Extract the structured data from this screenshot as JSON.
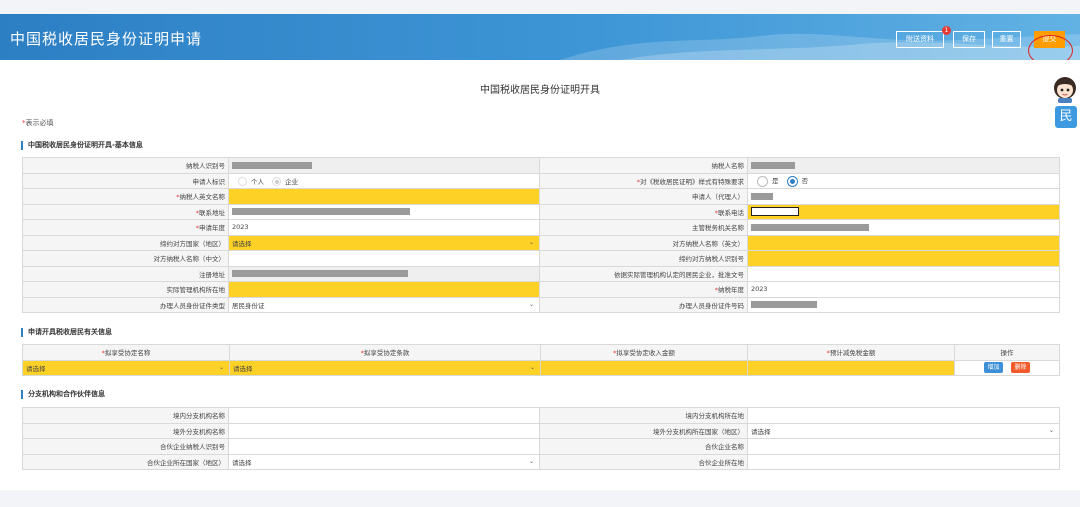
{
  "header": {
    "title": "中国税收居民身份证明申请",
    "buttons": {
      "attach": "附送资料",
      "save": "保存",
      "reset": "重置",
      "submit": "提交"
    },
    "attach_badge": "1"
  },
  "doc_title": "中国税收居民身份证明开具",
  "required_note": {
    "star": "*",
    "text": "表示必填"
  },
  "side_button": "民",
  "section1": {
    "title": "中国税收居民身份证明开具-基本信息",
    "rows": {
      "r1": {
        "l1": "纳税人识别号",
        "l2": "纳税人名称"
      },
      "r2": {
        "l1": "申请人标识",
        "opt_person": "个人",
        "opt_company": "企业",
        "l2": "对《税收居民证明》样式有特殊要求",
        "opt_yes": "是",
        "opt_no": "否"
      },
      "r3": {
        "l1": "纳税人英文名称",
        "l2": "申请人（代理人）"
      },
      "r4": {
        "l1": "联系地址",
        "l2": "联系电话"
      },
      "r5": {
        "l1": "申请年度",
        "v1": "2023",
        "l2": "主管税务机关名称"
      },
      "r6": {
        "l1": "缔约对方国家（地区）",
        "v1": "请选择",
        "l2": "对方纳税人名称（英文）"
      },
      "r7": {
        "l1": "对方纳税人名称（中文）",
        "l2": "缔约对方纳税人识别号"
      },
      "r8": {
        "l1": "注册地址",
        "l2": "依据实际管理机构认定的居民企业，批准文号"
      },
      "r9": {
        "l1": "实际管理机构所在地",
        "l2": "纳税年度",
        "v2": "2023"
      },
      "r10": {
        "l1": "办理人员身份证件类型",
        "v1": "居民身份证",
        "l2": "办理人员身份证件号码"
      }
    }
  },
  "section2": {
    "title": "申请开具税收居民有关信息",
    "headers": [
      "拟享受协定名称",
      "拟享受协定条款",
      "拟享受协定收入金额",
      "预计减免税金额",
      "操作"
    ],
    "row": {
      "treaty": "请选择",
      "clause": "请选择"
    },
    "add": "增加",
    "del": "删除"
  },
  "section3": {
    "title": "分支机构和合作伙伴信息",
    "rows": {
      "r1": {
        "l1": "境内分支机构名称",
        "l2": "境内分支机构所在地"
      },
      "r2": {
        "l1": "境外分支机构名称",
        "l2": "境外分支机构所在国家（地区）",
        "v2": "请选择"
      },
      "r3": {
        "l1": "合伙企业纳税人识别号",
        "l2": "合伙企业名称"
      },
      "r4": {
        "l1": "合伙企业所在国家（地区）",
        "v1": "请选择",
        "l2": "合伙企业所在地"
      }
    }
  },
  "colors": {
    "header_blue": "#2d7fc4",
    "required_yellow": "#fed127",
    "submit_orange": "#ff9c00",
    "highlight_red": "#e02020"
  }
}
